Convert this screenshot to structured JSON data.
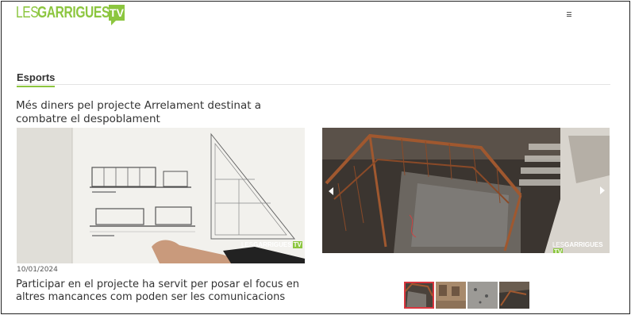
{
  "header": {
    "logo_les": "LES",
    "logo_garrigues": "GARRIGUES",
    "logo_tv": "TV",
    "menu_icon": "hamburger-icon"
  },
  "section": {
    "tab_label": "Esports"
  },
  "article_main": {
    "title": "Més diners pel projecte Arrelament destinat a combatre el despoblament",
    "date": "10/01/2024"
  },
  "article_secondary": {
    "title": "Participar en el projecte ha servit per posar el focus en altres mancances com poden ser les comunicacions"
  },
  "watermark": {
    "les": "LES",
    "garrigues": "GARRIGUES",
    "tv": "TV"
  },
  "gallery": {
    "prev_icon": "chevron-left-icon",
    "next_icon": "chevron-right-icon",
    "thumbnails": [
      "thumb-1",
      "thumb-2",
      "thumb-3",
      "thumb-4"
    ],
    "active_index": 0
  },
  "colors": {
    "brand_green": "#8cc63f",
    "active_thumb_border": "#d9363e"
  }
}
